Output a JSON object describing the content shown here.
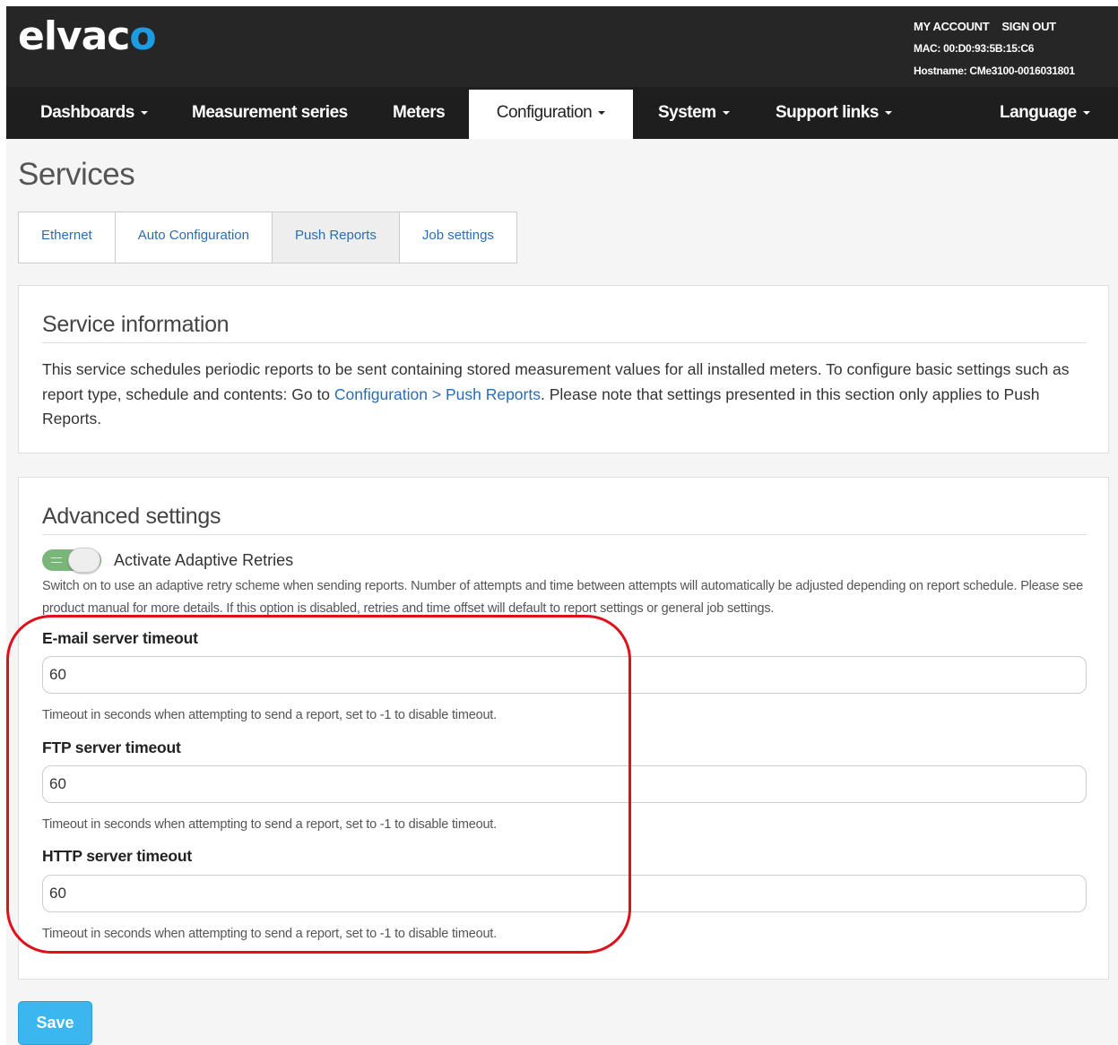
{
  "header": {
    "logo_text": "elvac",
    "logo_accent": "o",
    "my_account": "MY ACCOUNT",
    "sign_out": "SIGN OUT",
    "mac": "MAC: 00:D0:93:5B:15:C6",
    "hostname": "Hostname: CMe3100-0016031801"
  },
  "nav": {
    "items": [
      {
        "label": "Dashboards",
        "dropdown": true
      },
      {
        "label": "Measurement series",
        "dropdown": false
      },
      {
        "label": "Meters",
        "dropdown": false
      },
      {
        "label": "Configuration",
        "dropdown": true,
        "active": true
      },
      {
        "label": "System",
        "dropdown": true
      },
      {
        "label": "Support links",
        "dropdown": true
      },
      {
        "label": "Language",
        "dropdown": true
      }
    ]
  },
  "page": {
    "title": "Services"
  },
  "tabs": [
    {
      "label": "Ethernet"
    },
    {
      "label": "Auto Configuration"
    },
    {
      "label": "Push Reports",
      "active": true
    },
    {
      "label": "Job settings"
    }
  ],
  "service_info": {
    "heading": "Service information",
    "text_before": "This service schedules periodic reports to be sent containing stored measurement values for all installed meters. To configure basic settings such as report type, schedule and contents: Go to ",
    "link": "Configuration > Push Reports",
    "text_after": ". Please note that settings presented in this section only applies to Push Reports."
  },
  "advanced": {
    "heading": "Advanced settings",
    "adaptive_retries": {
      "label": "Activate Adaptive Retries",
      "enabled": true,
      "help": "Switch on to use an adaptive retry scheme when sending reports. Number of attempts and time between attempts will automatically be adjusted depending on report schedule. Please see product manual for more details. If this option is disabled, retries and time offset will default to report settings or general job settings."
    },
    "fields": [
      {
        "label": "E-mail server timeout",
        "value": "60",
        "help": "Timeout in seconds when attempting to send a report, set to -1 to disable timeout."
      },
      {
        "label": "FTP server timeout",
        "value": "60",
        "help": "Timeout in seconds when attempting to send a report, set to -1 to disable timeout."
      },
      {
        "label": "HTTP server timeout",
        "value": "60",
        "help": "Timeout in seconds when attempting to send a report, set to -1 to disable timeout."
      }
    ]
  },
  "actions": {
    "save_label": "Save"
  },
  "colors": {
    "brand_accent": "#1d9be3",
    "toggle_on": "#7ab679",
    "save_button": "#3bb6ef",
    "annotation": "#e0101a",
    "link": "#2a6db5"
  },
  "icons": {
    "dropdown": "caret-down-icon",
    "toggle_grip": "grip-lines-icon"
  }
}
